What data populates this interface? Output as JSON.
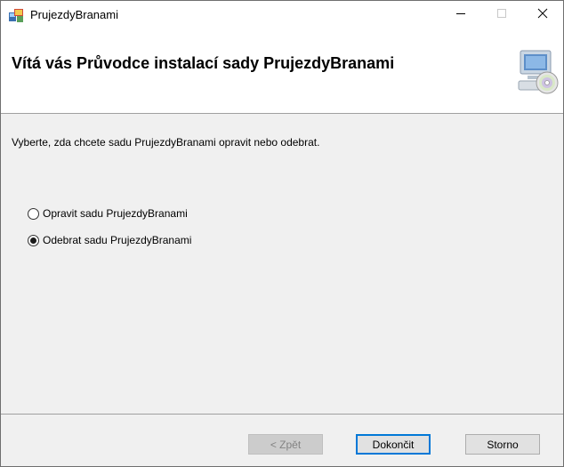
{
  "window": {
    "title": "PrujezdyBranami",
    "controls": [
      "minimize-icon",
      "maximize-icon",
      "close-icon"
    ]
  },
  "banner": {
    "title": "Vítá vás Průvodce instalací sady PrujezdyBranami",
    "icon": "computer-cd-icon"
  },
  "content": {
    "instruction": "Vyberte, zda chcete sadu PrujezdyBranami opravit nebo odebrat.",
    "options": [
      {
        "label": "Opravit sadu PrujezdyBranami",
        "selected": false
      },
      {
        "label": "Odebrat sadu PrujezdyBranami",
        "selected": true
      }
    ]
  },
  "buttons": {
    "back": "< Zpět",
    "finish": "Dokončit",
    "cancel": "Storno"
  },
  "colors": {
    "focus_border": "#0078d7",
    "dialog_bg": "#f0f0f0",
    "banner_bg": "#ffffff"
  }
}
